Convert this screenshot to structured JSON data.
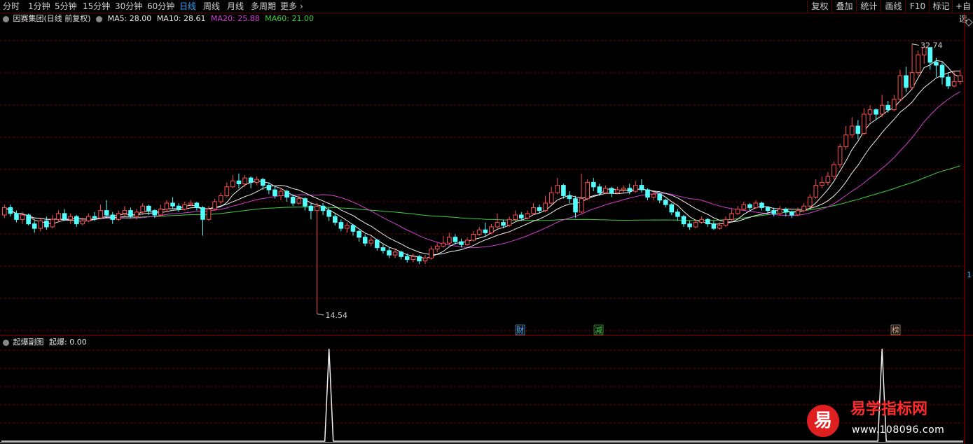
{
  "toolbar": {
    "left_items": [
      "分时",
      "1分钟",
      "5分钟",
      "15分钟",
      "30分钟",
      "60分钟",
      "日线",
      "周线",
      "月线",
      "多周期",
      "更多"
    ],
    "active": "日线",
    "more_arrow": "›",
    "right_items": [
      "复权",
      "叠加",
      "统计",
      "画线",
      "F10",
      "标记",
      "+自选"
    ],
    "scroll_icon": "▲"
  },
  "main_legend": {
    "title": "因赛集团(日线 前复权)",
    "toggle_icon": "circle-chevron-icon",
    "ma": [
      {
        "label": "MA5: 28.00",
        "color": "#e8e8e8"
      },
      {
        "label": "MA10: 28.61",
        "color": "#e8e8e8"
      },
      {
        "label": "MA20: 25.88",
        "color": "#d040d0"
      },
      {
        "label": "MA60: 21.00",
        "color": "#40d040"
      }
    ]
  },
  "price_annotations": {
    "high": "32.74",
    "low": "14.54"
  },
  "event_markers": [
    {
      "label": "财",
      "color": "#5ab4ff"
    },
    {
      "label": "减",
      "color": "#40d040"
    },
    {
      "label": "榜",
      "color": "#e0b090"
    }
  ],
  "right_marker": "1",
  "indicator": {
    "title": "起爆副图",
    "value_label": "起爆: 0.00"
  },
  "watermark": {
    "badge": "易",
    "name": "易学指标网",
    "url": "www.108096.com"
  },
  "colors": {
    "up": "#ff5050",
    "down": "#54ffff",
    "ma5": "#f0f0f0",
    "ma10": "#f0f0f0",
    "ma20": "#d040d0",
    "ma60": "#40d040",
    "grid": "#7a0000",
    "background": "#000000"
  },
  "chart_data": {
    "type": "candlestick",
    "period": "daily",
    "price_range": [
      13.5,
      34.0
    ],
    "candles": [
      [
        21.2,
        21.7,
        21.9,
        21.0
      ],
      [
        21.7,
        21.3,
        21.9,
        21.1
      ],
      [
        21.3,
        20.9,
        21.5,
        20.7
      ],
      [
        20.9,
        21.2,
        21.4,
        20.6
      ],
      [
        21.2,
        20.6,
        21.3,
        20.5
      ],
      [
        20.6,
        20.3,
        20.8,
        20.0
      ],
      [
        20.3,
        20.8,
        21.0,
        20.1
      ],
      [
        20.8,
        20.4,
        21.1,
        20.2
      ],
      [
        20.4,
        20.9,
        21.2,
        20.3
      ],
      [
        20.9,
        21.3,
        21.5,
        20.7
      ],
      [
        21.3,
        20.9,
        21.6,
        20.8
      ],
      [
        20.9,
        21.1,
        21.3,
        20.6
      ],
      [
        21.1,
        20.6,
        21.2,
        20.4
      ],
      [
        20.6,
        20.8,
        21.0,
        20.5
      ],
      [
        20.8,
        21.1,
        21.3,
        20.7
      ],
      [
        21.1,
        21.0,
        21.4,
        20.8
      ],
      [
        21.0,
        21.5,
        21.9,
        20.9
      ],
      [
        21.5,
        21.2,
        22.2,
        21.0
      ],
      [
        21.2,
        20.9,
        21.4,
        20.6
      ],
      [
        20.9,
        21.3,
        21.5,
        20.8
      ],
      [
        21.3,
        21.5,
        21.8,
        21.1
      ],
      [
        21.5,
        21.1,
        21.7,
        21.0
      ],
      [
        21.1,
        21.4,
        21.6,
        20.9
      ],
      [
        21.4,
        21.8,
        22.0,
        21.2
      ],
      [
        21.8,
        21.5,
        21.9,
        21.2
      ],
      [
        21.5,
        21.2,
        21.6,
        21.0
      ],
      [
        21.2,
        21.6,
        21.9,
        21.1
      ],
      [
        21.6,
        22.0,
        22.2,
        21.4
      ],
      [
        22.0,
        21.8,
        22.4,
        21.6
      ],
      [
        21.8,
        21.6,
        22.0,
        21.4
      ],
      [
        21.6,
        21.9,
        22.1,
        21.5
      ],
      [
        21.9,
        22.0,
        22.2,
        21.8
      ],
      [
        22.0,
        21.7,
        22.1,
        21.5
      ],
      [
        21.7,
        20.9,
        21.8,
        19.8
      ],
      [
        20.9,
        21.6,
        21.8,
        20.8
      ],
      [
        21.6,
        22.1,
        22.3,
        21.5
      ],
      [
        22.1,
        22.5,
        22.7,
        21.9
      ],
      [
        22.5,
        23.1,
        23.4,
        22.4
      ],
      [
        23.1,
        23.5,
        23.9,
        23.0
      ],
      [
        23.5,
        23.3,
        24.0,
        23.0
      ],
      [
        23.3,
        23.7,
        23.9,
        23.1
      ],
      [
        23.7,
        23.4,
        23.8,
        23.0
      ],
      [
        23.4,
        23.6,
        23.8,
        23.2
      ],
      [
        23.6,
        23.2,
        23.7,
        22.9
      ],
      [
        23.2,
        22.9,
        23.4,
        22.6
      ],
      [
        22.9,
        22.5,
        23.1,
        22.3
      ],
      [
        22.5,
        22.8,
        23.0,
        22.2
      ],
      [
        22.8,
        22.4,
        22.9,
        22.1
      ],
      [
        22.4,
        22.0,
        22.6,
        21.8
      ],
      [
        22.0,
        22.3,
        22.5,
        21.9
      ],
      [
        22.3,
        21.8,
        22.4,
        21.5
      ],
      [
        21.8,
        21.5,
        22.0,
        20.9
      ],
      [
        21.5,
        21.8,
        22.0,
        14.54
      ],
      [
        21.8,
        21.5,
        22.0,
        21.2
      ],
      [
        21.5,
        21.1,
        21.7,
        20.8
      ],
      [
        21.1,
        20.7,
        21.3,
        20.5
      ],
      [
        20.7,
        20.3,
        20.9,
        20.1
      ],
      [
        20.3,
        20.5,
        20.7,
        20.0
      ],
      [
        20.5,
        20.1,
        20.6,
        19.8
      ],
      [
        20.1,
        19.7,
        20.2,
        19.4
      ],
      [
        19.7,
        19.3,
        19.9,
        19.1
      ],
      [
        19.3,
        19.5,
        19.7,
        19.1
      ],
      [
        19.5,
        19.0,
        19.6,
        18.8
      ],
      [
        19.0,
        18.8,
        19.2,
        18.6
      ],
      [
        18.8,
        18.5,
        19.0,
        18.3
      ],
      [
        18.5,
        18.7,
        18.9,
        18.3
      ],
      [
        18.7,
        18.4,
        18.8,
        18.2
      ],
      [
        18.4,
        18.2,
        18.6,
        18.0
      ],
      [
        18.2,
        18.4,
        18.6,
        18.0
      ],
      [
        18.4,
        18.1,
        18.5,
        17.9
      ],
      [
        18.1,
        18.3,
        18.5,
        17.9
      ],
      [
        18.3,
        18.9,
        19.1,
        18.2
      ],
      [
        18.9,
        19.1,
        19.3,
        18.7
      ],
      [
        19.1,
        19.3,
        19.8,
        19.0
      ],
      [
        19.3,
        19.7,
        20.0,
        19.2
      ],
      [
        19.7,
        19.4,
        19.9,
        19.2
      ],
      [
        19.4,
        19.2,
        19.6,
        19.0
      ],
      [
        19.2,
        19.5,
        19.7,
        19.1
      ],
      [
        19.5,
        19.9,
        20.1,
        19.4
      ],
      [
        19.9,
        20.2,
        20.4,
        19.8
      ],
      [
        20.2,
        20.0,
        20.7,
        19.8
      ],
      [
        20.0,
        20.4,
        20.6,
        19.9
      ],
      [
        20.4,
        20.7,
        21.3,
        20.3
      ],
      [
        20.7,
        20.5,
        20.9,
        20.3
      ],
      [
        20.5,
        20.9,
        21.1,
        20.4
      ],
      [
        20.9,
        21.2,
        21.5,
        20.8
      ],
      [
        21.2,
        21.0,
        21.4,
        20.8
      ],
      [
        21.0,
        21.3,
        21.5,
        20.9
      ],
      [
        21.3,
        21.7,
        22.0,
        21.2
      ],
      [
        21.7,
        21.5,
        21.9,
        21.3
      ],
      [
        21.5,
        22.0,
        22.5,
        21.4
      ],
      [
        22.0,
        22.7,
        23.1,
        21.9
      ],
      [
        22.7,
        23.2,
        23.7,
        22.6
      ],
      [
        23.2,
        22.5,
        23.3,
        22.3
      ],
      [
        22.5,
        22.3,
        22.8,
        22.0
      ],
      [
        22.3,
        21.4,
        22.5,
        21.0
      ],
      [
        21.4,
        22.3,
        24.0,
        21.3
      ],
      [
        22.3,
        23.4,
        23.6,
        22.2
      ],
      [
        23.4,
        23.1,
        23.7,
        22.8
      ],
      [
        23.1,
        22.7,
        23.3,
        22.5
      ],
      [
        22.7,
        23.0,
        23.2,
        22.6
      ],
      [
        23.0,
        22.7,
        23.1,
        22.4
      ],
      [
        22.7,
        22.9,
        23.1,
        22.6
      ],
      [
        22.9,
        23.0,
        23.2,
        22.7
      ],
      [
        23.0,
        22.8,
        23.3,
        22.6
      ],
      [
        22.8,
        23.2,
        23.5,
        22.7
      ],
      [
        23.2,
        22.9,
        23.6,
        22.7
      ],
      [
        22.9,
        22.4,
        23.0,
        22.2
      ],
      [
        22.4,
        22.6,
        22.8,
        22.2
      ],
      [
        22.6,
        22.2,
        22.7,
        22.0
      ],
      [
        22.2,
        21.9,
        22.3,
        21.7
      ],
      [
        21.9,
        21.4,
        22.0,
        21.2
      ],
      [
        21.4,
        21.1,
        21.6,
        20.8
      ],
      [
        21.1,
        20.6,
        21.2,
        20.4
      ],
      [
        20.6,
        20.4,
        20.8,
        20.2
      ],
      [
        20.4,
        20.7,
        20.9,
        20.3
      ],
      [
        20.7,
        20.9,
        21.1,
        20.6
      ],
      [
        20.9,
        20.6,
        21.0,
        20.4
      ],
      [
        20.6,
        20.3,
        20.8,
        20.2
      ],
      [
        20.3,
        20.5,
        20.7,
        20.2
      ],
      [
        20.5,
        20.9,
        21.1,
        20.4
      ],
      [
        20.9,
        21.3,
        21.6,
        20.8
      ],
      [
        21.3,
        21.6,
        21.8,
        21.2
      ],
      [
        21.6,
        21.9,
        22.1,
        21.5
      ],
      [
        21.9,
        21.7,
        22.0,
        21.5
      ],
      [
        21.7,
        22.0,
        22.2,
        21.6
      ],
      [
        22.0,
        21.7,
        22.1,
        21.5
      ],
      [
        21.7,
        21.5,
        21.8,
        21.3
      ],
      [
        21.5,
        21.3,
        21.7,
        21.1
      ],
      [
        21.3,
        21.6,
        21.8,
        21.2
      ],
      [
        21.6,
        21.4,
        21.7,
        21.1
      ],
      [
        21.4,
        21.2,
        21.5,
        21.0
      ],
      [
        21.2,
        21.5,
        21.7,
        21.1
      ],
      [
        21.5,
        21.8,
        22.0,
        21.4
      ],
      [
        21.8,
        22.4,
        22.6,
        21.7
      ],
      [
        22.4,
        23.2,
        23.6,
        22.3
      ],
      [
        23.2,
        23.4,
        23.8,
        23.0
      ],
      [
        23.4,
        23.8,
        24.1,
        23.2
      ],
      [
        23.8,
        24.6,
        24.8,
        23.6
      ],
      [
        24.6,
        25.8,
        26.0,
        24.4
      ],
      [
        25.8,
        26.6,
        27.2,
        25.6
      ],
      [
        26.6,
        27.2,
        27.8,
        26.4
      ],
      [
        27.2,
        26.7,
        27.6,
        26.3
      ],
      [
        26.7,
        28.0,
        28.4,
        26.6
      ],
      [
        28.0,
        28.3,
        28.6,
        27.5
      ],
      [
        28.3,
        28.0,
        28.4,
        27.6
      ],
      [
        28.0,
        28.6,
        29.3,
        27.8
      ],
      [
        28.6,
        28.3,
        28.9,
        28.1
      ],
      [
        28.3,
        29.0,
        29.3,
        28.2
      ],
      [
        29.0,
        30.6,
        31.0,
        28.9
      ],
      [
        30.6,
        29.8,
        31.2,
        29.5
      ],
      [
        29.8,
        30.8,
        32.74,
        29.7
      ],
      [
        30.8,
        32.0,
        32.3,
        30.6
      ],
      [
        32.0,
        32.5,
        32.5,
        31.4
      ],
      [
        32.5,
        31.5,
        32.5,
        31.0
      ],
      [
        31.5,
        31.3,
        31.8,
        30.5
      ],
      [
        31.3,
        30.5,
        31.5,
        30.0
      ],
      [
        30.5,
        29.9,
        30.8,
        29.7
      ],
      [
        29.9,
        30.2,
        30.9,
        29.8
      ],
      [
        30.2,
        30.6,
        31.0,
        30.0
      ]
    ],
    "ma_series": [
      "MA5",
      "MA10",
      "MA20",
      "MA60"
    ],
    "indicator_series": {
      "name": "起爆",
      "spikes_at_index": [
        54,
        146
      ],
      "baseline": 0,
      "spike_value": 1
    }
  }
}
